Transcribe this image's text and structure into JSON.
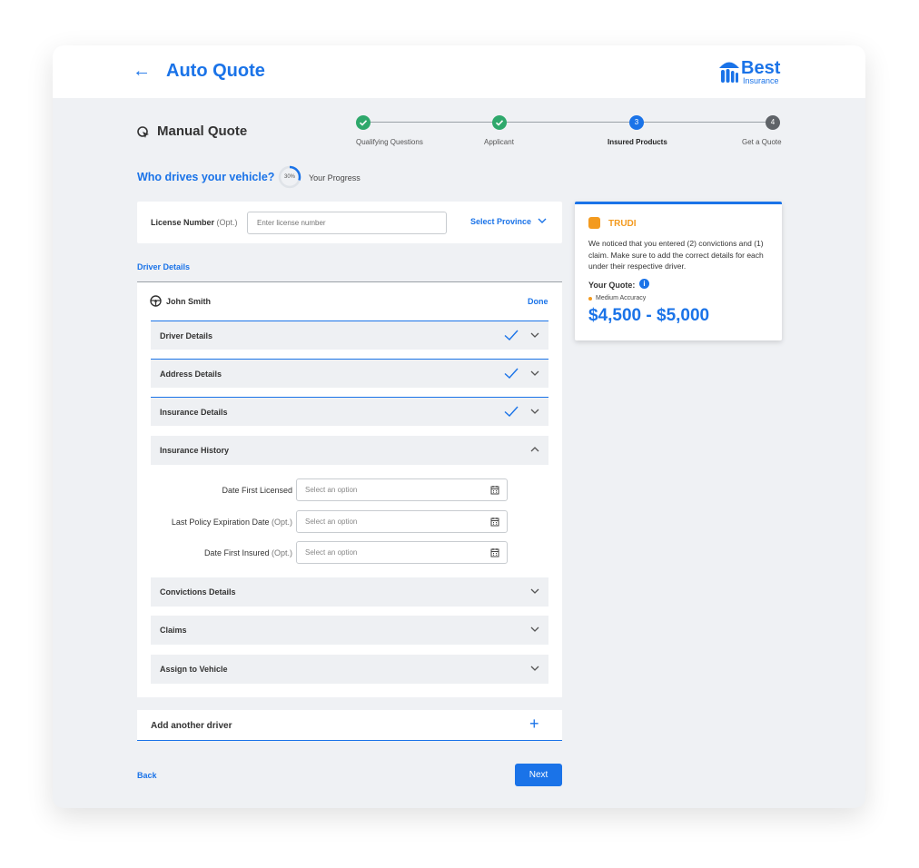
{
  "header": {
    "title": "Auto Quote",
    "logo_name": "Best",
    "logo_sub": "Insurance"
  },
  "page": {
    "subtitle": "Manual Quote",
    "question": "Who drives your vehicle?",
    "progress_pct": "30%",
    "progress_value": 0.3,
    "progress_label": "Your Progress"
  },
  "stepper": {
    "steps": [
      {
        "label": "Qualifying Questions",
        "status": "done",
        "number": ""
      },
      {
        "label": "Applicant",
        "status": "done",
        "number": ""
      },
      {
        "label": "Insured Products",
        "status": "active",
        "number": "3"
      },
      {
        "label": "Get a Quote",
        "status": "todo",
        "number": "4"
      }
    ]
  },
  "license": {
    "label": "License Number",
    "optional": "(Opt.)",
    "placeholder": "Enter license number",
    "province_label": "Select Province"
  },
  "driver_section": {
    "heading": "Driver Details",
    "driver_name": "John Smith",
    "done_label": "Done",
    "accordions": [
      {
        "label": "Driver Details",
        "completed": true
      },
      {
        "label": "Address Details",
        "completed": true
      },
      {
        "label": "Insurance Details",
        "completed": true
      },
      {
        "label": "Insurance History",
        "expanded": true
      },
      {
        "label": "Convictions Details"
      },
      {
        "label": "Claims"
      },
      {
        "label": "Assign to Vehicle"
      }
    ],
    "history_fields": [
      {
        "label": "Date First Licensed",
        "optional": "",
        "placeholder": "Select an option"
      },
      {
        "label": "Last Policy Expiration Date",
        "optional": "(Opt.)",
        "placeholder": "Select an option"
      },
      {
        "label": "Date First Insured",
        "optional": "(Opt.)",
        "placeholder": "Select an option"
      }
    ]
  },
  "add_driver": {
    "label": "Add another driver"
  },
  "footer": {
    "back": "Back",
    "next": "Next"
  },
  "trudi": {
    "name": "TRUDI",
    "message": "We noticed that you entered (2) convictions and (1) claim. Make sure to add the correct details for each under their respective driver.",
    "quote_label": "Your Quote:",
    "accuracy": "Medium Accuracy",
    "quote_range": "$4,500 - $5,000"
  },
  "colors": {
    "accent": "#1a73e8",
    "success": "#2ea86b",
    "warning": "#f39a1e"
  }
}
